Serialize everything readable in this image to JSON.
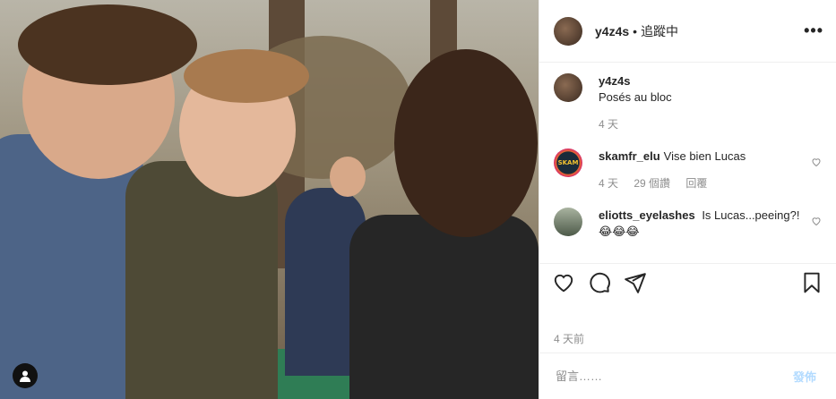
{
  "header": {
    "username": "y4z4s",
    "separator": "•",
    "follow_status": "追蹤中",
    "more_icon": "more-horizontal-icon"
  },
  "caption": {
    "username": "y4z4s",
    "text": "Posés au bloc",
    "time": "4 天"
  },
  "comments": [
    {
      "username": "skamfr_elu",
      "text": "Vise bien Lucas",
      "time": "4 天",
      "likes": "29 個讚",
      "reply": "回覆",
      "avatar_text": "SKAM"
    },
    {
      "username": "eliotts_eyelashes",
      "text": "Is Lucas...peeing?!😂😂😂"
    }
  ],
  "actions": {
    "like_icon": "heart-icon",
    "comment_icon": "comment-icon",
    "share_icon": "send-icon",
    "save_icon": "bookmark-icon"
  },
  "post_time": "4 天前",
  "comment_box": {
    "placeholder": "留言……",
    "post_label": "發佈"
  },
  "colors": {
    "text": "#262626",
    "muted": "#8e8e8e",
    "border": "#efefef",
    "post_disabled": "#b3dbff"
  }
}
